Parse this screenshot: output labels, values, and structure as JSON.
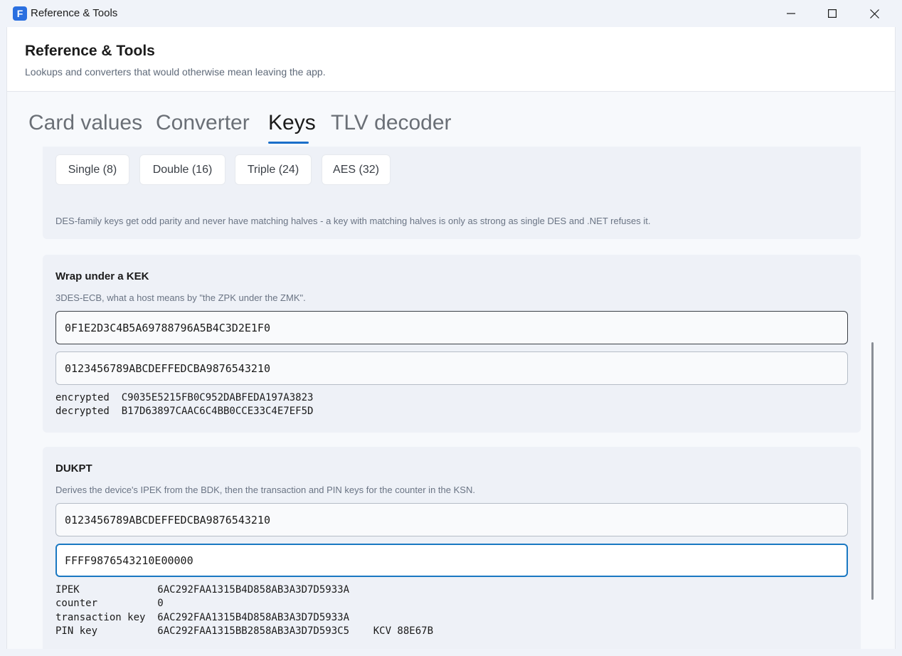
{
  "window": {
    "title": "Reference & Tools",
    "app_icon_letter": "F"
  },
  "header": {
    "title": "Reference & Tools",
    "subtitle": "Lookups and converters that would otherwise mean leaving the app."
  },
  "tabs": [
    {
      "label": "Card values",
      "active": false
    },
    {
      "label": "Converter",
      "active": false
    },
    {
      "label": "Keys",
      "active": true
    },
    {
      "label": "TLV decoder",
      "active": false
    }
  ],
  "key_length": {
    "options": [
      "Single (8)",
      "Double (16)",
      "Triple (24)",
      "AES (32)"
    ],
    "note": "DES-family keys get odd parity and never have matching halves - a key with matching halves is only as strong as single DES and .NET refuses it."
  },
  "wrap": {
    "title": "Wrap under a KEK",
    "description": "3DES-ECB, what a host means by \"the ZPK under the ZMK\".",
    "kek_value": "0F1E2D3C4B5A69788796A5B4C3D2E1F0",
    "key_value": "0123456789ABCDEFFEDCBA9876543210",
    "encrypted_line": "encrypted  C9035E5215FB0C952DABFEDA197A3823",
    "decrypted_line": "decrypted  B17D63897CAAC6C4BB0CCE33C4E7EF5D"
  },
  "dukpt": {
    "title": "DUKPT",
    "description": "Derives the device's IPEK from the BDK, then the transaction and PIN keys for the counter in the KSN.",
    "bdk_value": "0123456789ABCDEFFEDCBA9876543210",
    "ksn_value": "FFFF9876543210E00000",
    "ipek_line": "IPEK             6AC292FAA1315B4D858AB3A3D7D5933A",
    "counter_line": "counter          0",
    "transaction_line": "transaction key  6AC292FAA1315B4D858AB3A3D7D5933A",
    "pin_line": "PIN key          6AC292FAA1315BB2858AB3A3D7D593C5    KCV 88E67B"
  },
  "colors": {
    "accent": "#1a6fc9",
    "focus": "#1a78c2"
  },
  "icons": [
    "minimize-icon",
    "maximize-icon",
    "close-icon"
  ]
}
